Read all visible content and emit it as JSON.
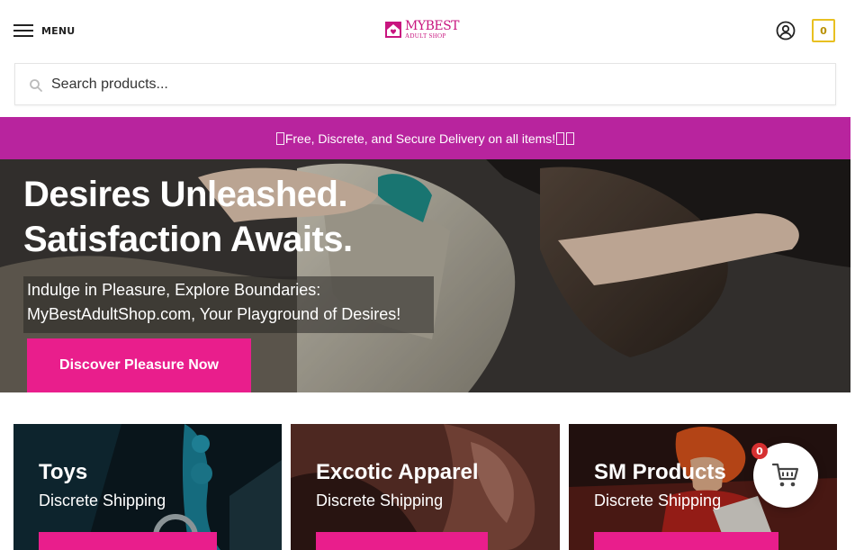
{
  "header": {
    "menu_label": "MENU",
    "logo_top": "MYBEST",
    "logo_bottom": "ADULT SHOP",
    "cart_count": "0"
  },
  "search": {
    "placeholder": "Search products..."
  },
  "promo": {
    "text": " Free, Discrete, and Secure Delivery on all items! "
  },
  "hero": {
    "title_line1": "Desires Unleashed.",
    "title_line2": "Satisfaction Awaits.",
    "tagline_line1": "Indulge in Pleasure, Explore Boundaries:",
    "tagline_line2": "MyBestAdultShop.com, Your Playground of Desires!",
    "cta_label": "Discover Pleasure Now"
  },
  "categories": [
    {
      "title": "Toys",
      "subtitle": "Discrete Shipping"
    },
    {
      "title": "Excotic Apparel",
      "subtitle": "Discrete Shipping"
    },
    {
      "title": "SM Products",
      "subtitle": "Discrete Shipping"
    }
  ],
  "floating_cart": {
    "count": "0"
  },
  "icons": {
    "menu": "hamburger-icon",
    "account": "user-circle-icon",
    "search": "search-icon",
    "cart": "cart-icon"
  },
  "colors": {
    "brand_pink": "#e91e8c",
    "promo_bar": "#b8249e",
    "cart_border": "#e8c021",
    "badge_red": "#d63031"
  }
}
